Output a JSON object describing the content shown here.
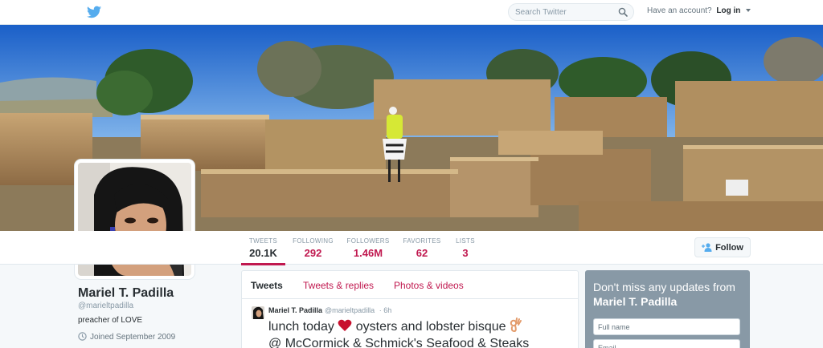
{
  "nav": {
    "search_placeholder": "Search Twitter",
    "account_prompt": "Have an account?",
    "login_label": "Log in"
  },
  "stats": [
    {
      "label": "TWEETS",
      "value": "20.1K"
    },
    {
      "label": "FOLLOWING",
      "value": "292"
    },
    {
      "label": "FOLLOWERS",
      "value": "1.46M"
    },
    {
      "label": "FAVORITES",
      "value": "62"
    },
    {
      "label": "LISTS",
      "value": "3"
    }
  ],
  "follow_label": "Follow",
  "profile": {
    "name": "Mariel T. Padilla",
    "handle": "@marieltpadilla",
    "bio": "preacher of LOVE",
    "joined": "Joined September 2009"
  },
  "timeline": {
    "tabs": [
      "Tweets",
      "Tweets & replies",
      "Photos & videos"
    ],
    "tweet": {
      "author": "Mariel T. Padilla",
      "handle": "@marieltpadilla",
      "time": "· 6h",
      "text_before": "lunch today",
      "text_after": "oysters and lobster bisque",
      "text_line2": "@ McCormick & Schmick's Seafood & Steaks"
    }
  },
  "signup": {
    "prefix": "Don't miss any updates from",
    "name": "Mariel T. Padilla",
    "fullname_placeholder": "Full name",
    "email_placeholder": "Email"
  },
  "colors": {
    "accent": "#c0184f",
    "twitter_blue": "#55acee",
    "signup_bg": "#8899a6"
  },
  "icons": [
    "twitter-bird-icon",
    "search-icon",
    "chevron-down-icon",
    "follow-person-icon",
    "calendar-icon",
    "heart-emoji",
    "ok-hand-emoji"
  ]
}
